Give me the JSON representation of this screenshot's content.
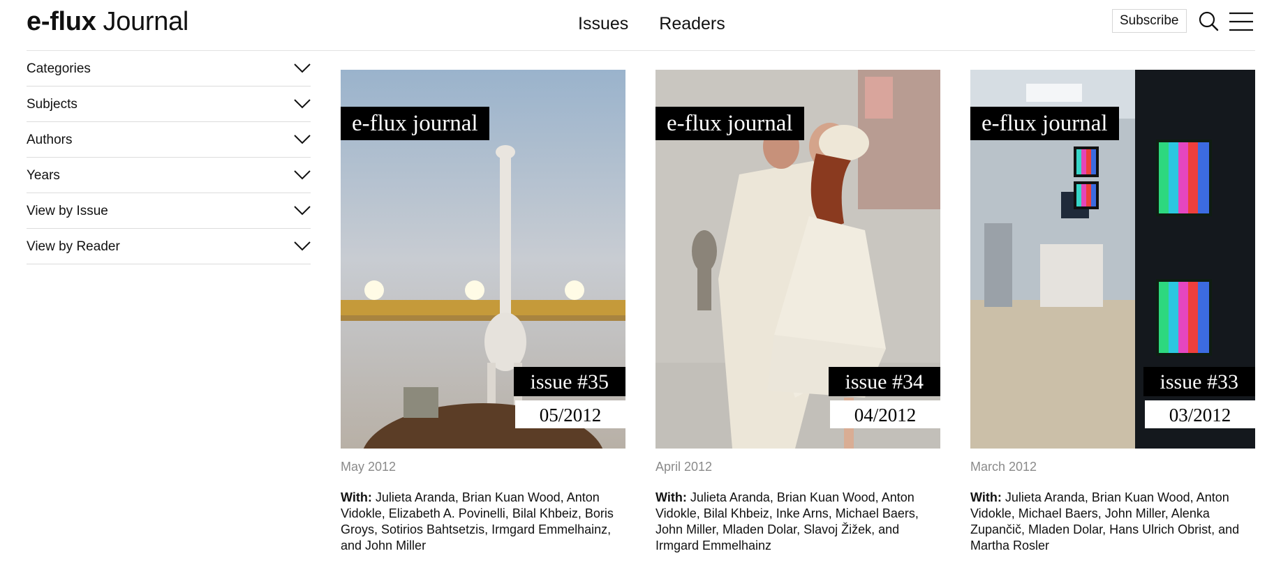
{
  "header": {
    "logo_brand": "e-flux",
    "logo_sub": "Journal",
    "nav": [
      "Issues",
      "Readers"
    ],
    "subscribe_label": "Subscribe",
    "search_icon": "search-icon",
    "menu_icon": "hamburger-menu-icon"
  },
  "sidebar": {
    "filters": [
      {
        "label": "Categories"
      },
      {
        "label": "Subjects"
      },
      {
        "label": "Authors"
      },
      {
        "label": "Years"
      },
      {
        "label": "View by Issue"
      },
      {
        "label": "View by Reader"
      }
    ],
    "chevron_icon": "chevron-down-icon"
  },
  "issues": [
    {
      "brand": "e-flux journal",
      "issue": "issue #35",
      "date": "05/2012",
      "month": "May 2012",
      "with_label": "With:",
      "contributors": "Julieta Aranda, Brian Kuan Wood, Anton Vidokle, Elizabeth A. Povinelli, Bilal Khbeiz, Boris Groys, Sotirios Bahtsetzis, Irmgard Emmelhainz, and John Miller"
    },
    {
      "brand": "e-flux journal",
      "issue": "issue #34",
      "date": "04/2012",
      "month": "April 2012",
      "with_label": "With:",
      "contributors": "Julieta Aranda, Brian Kuan Wood, Anton Vidokle, Bilal Khbeiz, Inke Arns, Michael Baers, John Miller, Mladen Dolar, Slavoj Žižek, and Irmgard Emmelhainz"
    },
    {
      "brand": "e-flux journal",
      "issue": "issue #33",
      "date": "03/2012",
      "month": "March 2012",
      "with_label": "With:",
      "contributors": "Julieta Aranda, Brian Kuan Wood, Anton Vidokle, Michael Baers, John Miller, Alenka Zupančič, Mladen Dolar, Hans Ulrich Obrist, and Martha Rosler"
    }
  ]
}
